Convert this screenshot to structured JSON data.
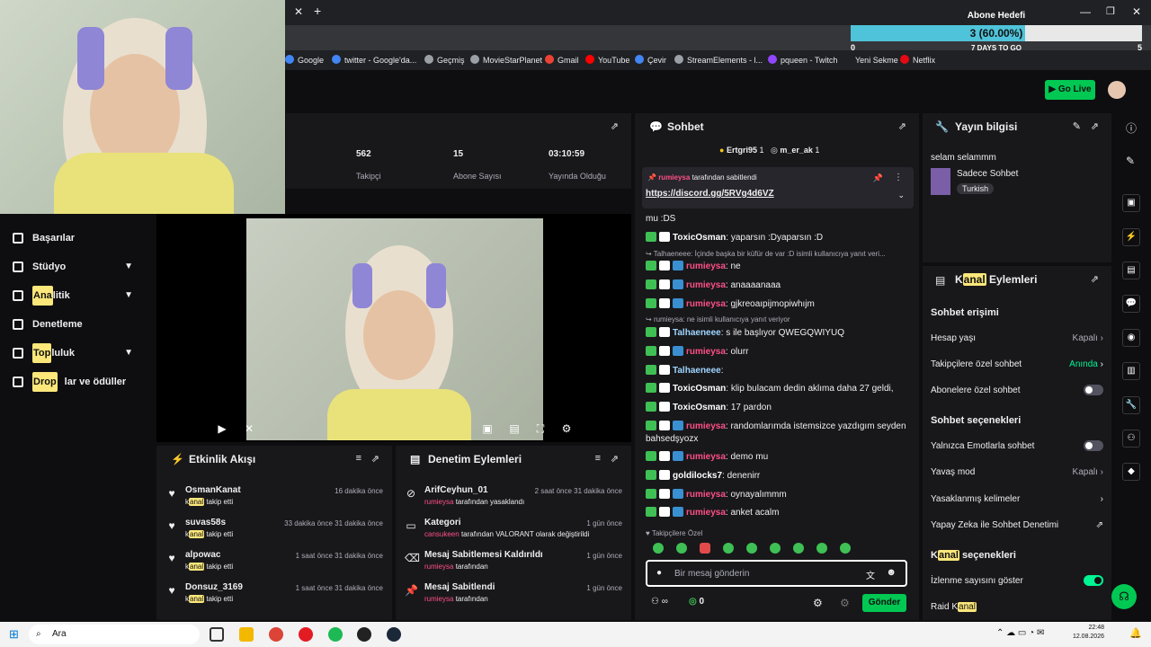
{
  "overlay": {
    "goal_title": "Abone Hedefi",
    "goal_value": "3 (60.00%)",
    "goal_progress": 0.6,
    "goal_min": "0",
    "goal_max": "5",
    "goal_days": "7 DAYS TO GO"
  },
  "bookmarks": [
    "Google",
    "twitter - Google'da...",
    "Geçmiş",
    "MovieStarPlanet",
    "Gmail",
    "YouTube",
    "Çevir",
    "StreamElements - l...",
    "pqueen - Twitch",
    "Yeni Sekme",
    "Netflix"
  ],
  "topbar": {
    "go_live": "Go Live"
  },
  "sidebar": {
    "items": [
      {
        "label": "Başarılar",
        "hl": "",
        "rest": ""
      },
      {
        "label": "Stüdyo",
        "hl": "",
        "rest": ""
      },
      {
        "label": "",
        "hl": "Ana",
        "rest": "litik"
      },
      {
        "label": "Denetleme",
        "hl": "",
        "rest": ""
      },
      {
        "label": "",
        "hl": "Top",
        "rest": "luluk"
      },
      {
        "label": "",
        "hl": "Drop",
        "rest": "lar ve ödüller"
      }
    ]
  },
  "stats": [
    {
      "value": "562",
      "label": "Takipçi"
    },
    {
      "value": "15",
      "label": "Abone Sayısı"
    },
    {
      "value": "03:10:59",
      "label": "Yayında Olduğu"
    }
  ],
  "activity": {
    "title": "Etkinlik Akışı",
    "items": [
      {
        "name": "OsmanKanat",
        "sub_hl": "anal",
        "sub": "takip etti",
        "time": "16 dakika önce"
      },
      {
        "name": "suvas58s",
        "sub_hl": "anal",
        "sub": "takip etti",
        "time": "33 dakika önce 31 dakika önce"
      },
      {
        "name": "alpowac",
        "sub_hl": "anal",
        "sub": "takip etti",
        "time": "1 saat önce 31 dakika önce"
      },
      {
        "name": "Donsuz_3169",
        "sub_hl": "anal",
        "sub": "takip etti",
        "time": "1 saat önce 31 dakika önce"
      }
    ]
  },
  "moderation": {
    "title": "Denetim Eylemleri",
    "items": [
      {
        "name": "ArifCeyhun_01",
        "sub_user": "rumieysa",
        "sub": "tarafından yasaklandı",
        "time": "2 saat önce 31 dakika önce"
      },
      {
        "name": "Kategori",
        "sub_user": "cansukeen",
        "sub": "tarafından VALORANT olarak değiştirildi",
        "time": "1 gün önce"
      },
      {
        "name": "Mesaj Sabitlemesi Kaldırıldı",
        "sub_user": "rumieysa",
        "sub": "tarafından",
        "time": "1 gün önce"
      },
      {
        "name": "Mesaj Sabitlendi",
        "sub_user": "rumieysa",
        "sub": "tarafından",
        "time": "1 gün önce"
      }
    ]
  },
  "chat": {
    "title": "Sohbet",
    "top_chatters": [
      "Ertgri95",
      "1",
      "m_er_ak",
      "1"
    ],
    "pinned_by": "rumieysa",
    "pinned_suffix": "tarafından sabitlendi",
    "pinned_link": "https://discord.gg/5RVg4d6VZ",
    "messages": [
      {
        "user": "",
        "text": "mu :DS",
        "color": "u3"
      },
      {
        "user": "ToxicOsman",
        "text": ": yaparsın :Dyaparsın :D",
        "color": "u3"
      },
      {
        "reply": "Talhaeneee: İçinde başka bir küfür de var :D isimli kullanıcıya yanıt veri..."
      },
      {
        "user": "rumieysa",
        "text": ": ne",
        "color": "u1"
      },
      {
        "user": "rumieysa",
        "text": ": anaaaanaaa",
        "color": "u1"
      },
      {
        "user": "rumieysa",
        "text": ": gjkreoaıpijmopiwhıjm",
        "color": "u1"
      },
      {
        "reply": "rumieysa: ne isimli kullanıcıya yanıt veriyor"
      },
      {
        "user": "Talhaeneee",
        "text": ": s ile başlıyor QWEGQWIYUQ",
        "color": "u2"
      },
      {
        "user": "rumieysa",
        "text": ": olurr",
        "color": "u1"
      },
      {
        "user": "Talhaeneee",
        "text": ":",
        "color": "u2"
      },
      {
        "user": "ToxicOsman",
        "text": ": klip bulacam dedin aklıma daha 27 geldi,",
        "color": "u3"
      },
      {
        "user": "ToxicOsman",
        "text": ": 17 pardon",
        "color": "u3"
      },
      {
        "user": "rumieysa",
        "text": ": randomlarımda istemsizce yazdıgım seyden",
        "color": "u1"
      },
      {
        "user": "",
        "text": "bahsedşyozx",
        "color": "u3"
      },
      {
        "user": "rumieysa",
        "text": ": demo mu",
        "color": "u1"
      },
      {
        "user": "goldilocks7",
        "text": ": denenirr",
        "color": "u3"
      },
      {
        "user": "rumieysa",
        "text": ": oynayalımmm",
        "color": "u1"
      },
      {
        "user": "rumieysa",
        "text": ": anket acalm",
        "color": "u1"
      }
    ],
    "follower_only": "Takipçilere Özel",
    "input_placeholder": "Bir mesaj gönderin",
    "points": "0",
    "send": "Gönder"
  },
  "stream_info": {
    "title": "Yayın bilgisi",
    "stream_title": "selam selammm",
    "category": "Sadece Sohbet",
    "tag": "Turkish"
  },
  "channel_actions": {
    "title_hl": "anal",
    "title_pre": "K",
    "title_post": "Eylemleri",
    "access_title": "Sohbet erişimi",
    "rows": [
      {
        "label": "Hesap yaşı",
        "value": "Kapalı"
      },
      {
        "label": "Takipçilere özel sohbet",
        "value": "Anında"
      },
      {
        "label": "Abonelere özel sohbet",
        "value": ""
      }
    ],
    "options_title": "Sohbet seçenekleri",
    "rows2": [
      {
        "label": "Yalnızca Emotlarla sohbet",
        "value": ""
      },
      {
        "label": "Yavaş mod",
        "value": "Kapalı"
      },
      {
        "label": "Yasaklanmış kelimeler",
        "value": ""
      },
      {
        "label": "Yapay Zeka ile Sohbet Denetimi",
        "value": ""
      }
    ],
    "channel_opts_pre": "K",
    "channel_opts_hl": "anal",
    "channel_opts_post": "seçenekleri",
    "rows3": [
      {
        "label": "İzlenme sayısını göster",
        "value": ""
      },
      {
        "label": "Raid K",
        "hl": "anal"
      }
    ]
  },
  "taskbar": {
    "search": "Ara",
    "time": "22:48",
    "date": "12.08.2026"
  },
  "colors": {
    "accent": "#00f593",
    "highlight": "#fbe77a",
    "chat_user_pink": "#ff4f86"
  }
}
